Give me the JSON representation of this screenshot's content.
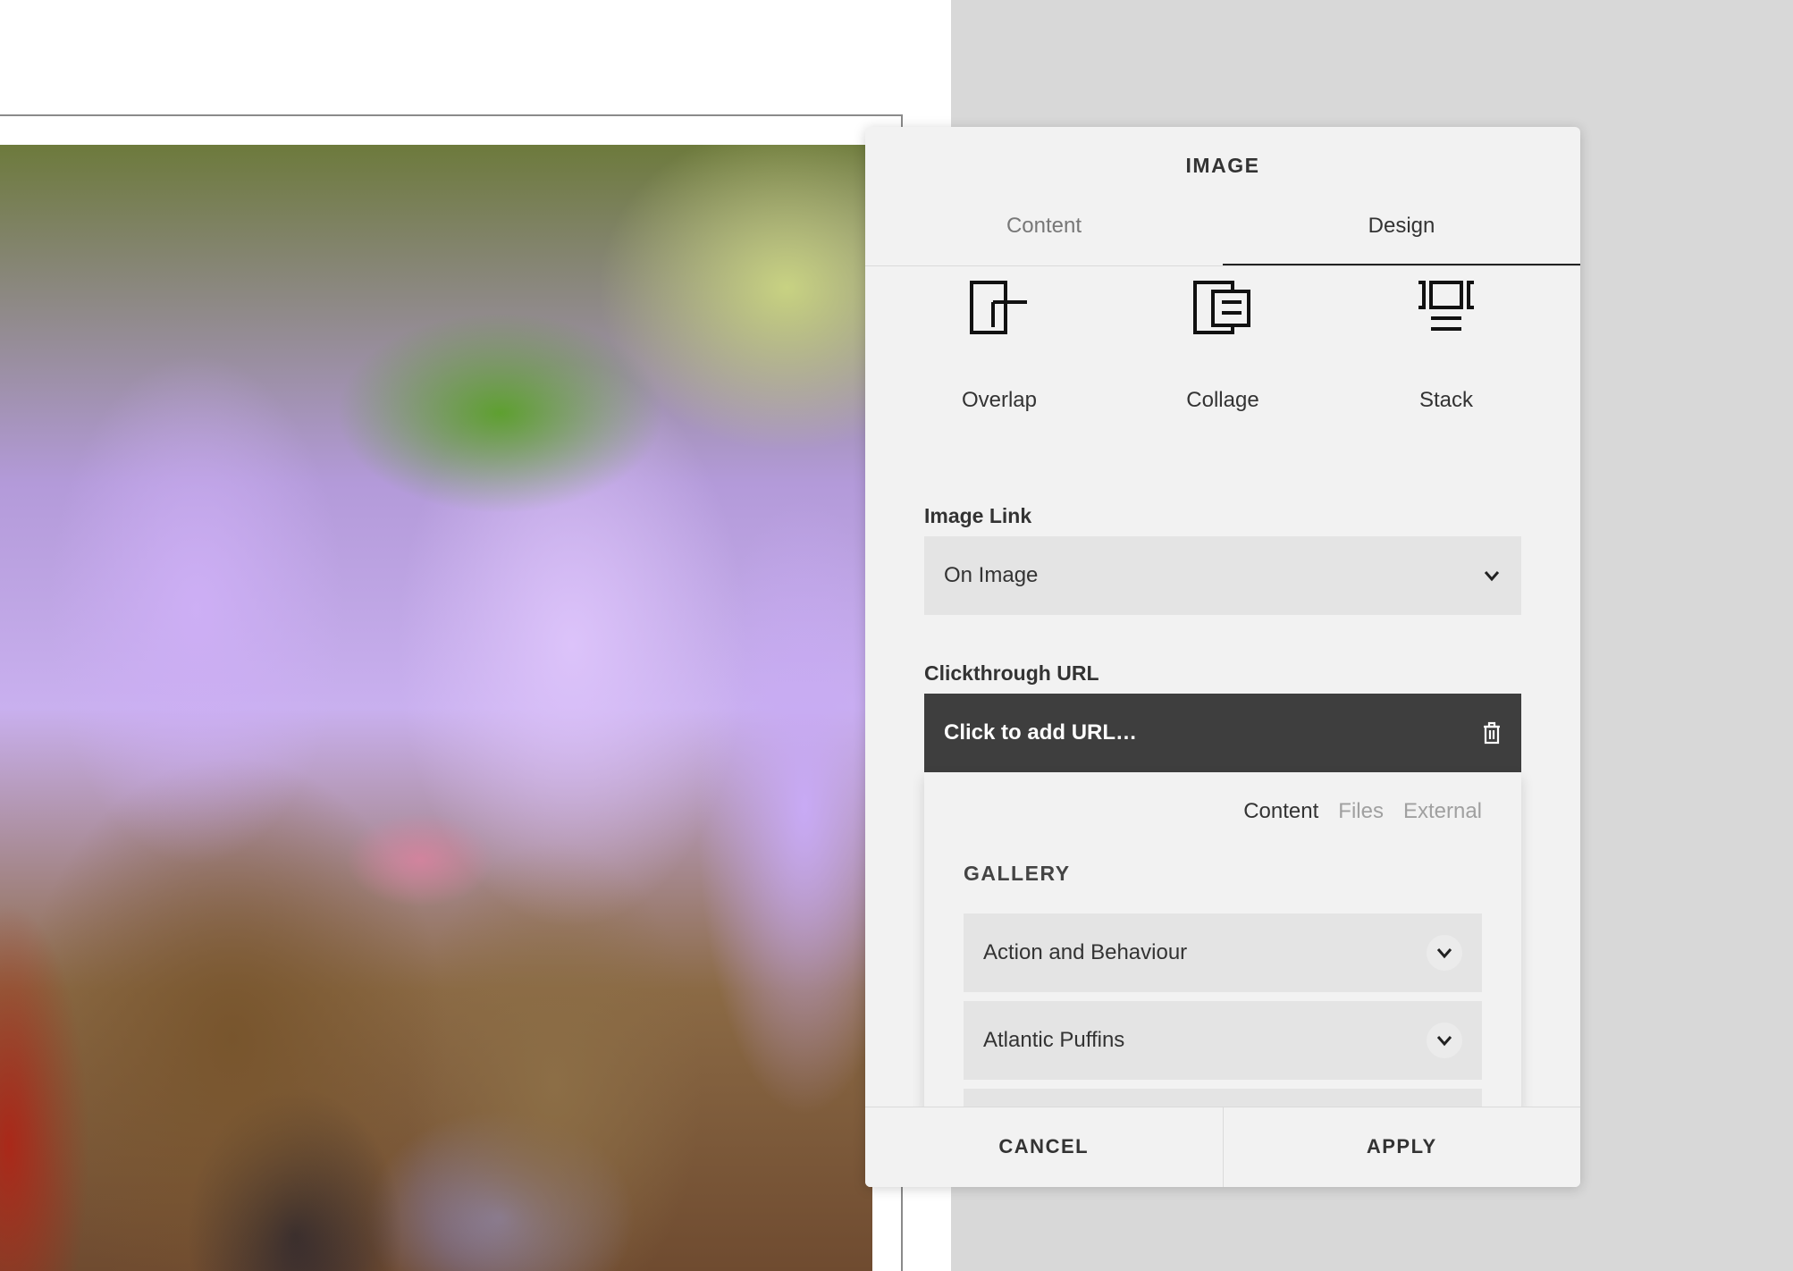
{
  "panel": {
    "title": "IMAGE",
    "tabs": [
      {
        "label": "Content",
        "active": false
      },
      {
        "label": "Design",
        "active": true
      }
    ]
  },
  "layouts": [
    {
      "label": "Overlap",
      "icon": "overlap-layout-icon"
    },
    {
      "label": "Collage",
      "icon": "collage-layout-icon"
    },
    {
      "label": "Stack",
      "icon": "stack-layout-icon"
    }
  ],
  "image_link": {
    "label": "Image Link",
    "value": "On Image"
  },
  "clickthrough": {
    "label": "Clickthrough URL",
    "placeholder": "Click to add URL…"
  },
  "link_picker": {
    "tabs": [
      {
        "label": "Content",
        "active": true
      },
      {
        "label": "Files",
        "active": false
      },
      {
        "label": "External",
        "active": false
      }
    ],
    "section_title": "GALLERY",
    "items": [
      "Action and Behaviour",
      "Atlantic Puffins"
    ]
  },
  "footer": {
    "cancel": "CANCEL",
    "apply": "APPLY"
  },
  "colors": {
    "panel_bg": "#f2f2f2",
    "url_bar_bg": "#3e3e3e",
    "field_bg": "#e4e4e4",
    "backdrop": "#d8d8d8"
  }
}
